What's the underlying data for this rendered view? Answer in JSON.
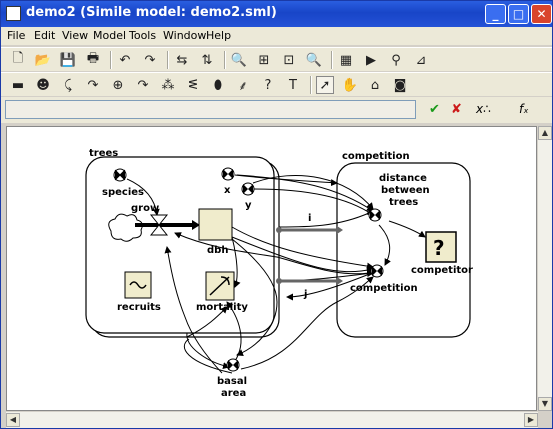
{
  "window": {
    "title": "demo2 (Simile model: demo2.sml)"
  },
  "menu": [
    "File",
    "Edit",
    "View",
    "Model",
    "Tools",
    "Window",
    "Help"
  ],
  "title_buttons": {
    "minimize": "_",
    "maximize": "□",
    "close": "✕"
  },
  "toolbar1_icons": [
    "new-file-icon",
    "open-folder-icon",
    "save-icon",
    "print-icon",
    "undo-icon",
    "redo-icon",
    "flip-horizontal-icon",
    "flip-vertical-icon",
    "zoom-in-icon",
    "zoom-fit-icon",
    "zoom-select-icon",
    "zoom-out-icon",
    "grid-icon",
    "run-icon",
    "binoculars-icon",
    "graph-icon"
  ],
  "toolbar2_icons": [
    "compartment-tool-icon",
    "variable-tool-icon",
    "flow-tool-icon",
    "influence-tool-icon",
    "submodel-tool-icon",
    "role-arrow-icon",
    "condition-tool-icon",
    "event-tool-icon",
    "migration-tool-icon",
    "function-tool-icon",
    "help-tool-icon",
    "text-tool-icon",
    "pointer-tool-icon",
    "hand-tool-icon",
    "plugin-tool-icon",
    "camera-tool-icon"
  ],
  "toolbar2_glyphs": [
    "▬",
    "☻",
    "⤹",
    "↷",
    "⊕",
    "↷",
    "⁂",
    "ᓬ",
    "⬮",
    "⸙",
    "?",
    "T",
    "➚",
    "✋",
    "⌂",
    "◙"
  ],
  "toolbar1_glyphs": [
    "🗋",
    "📂",
    "💾",
    "🖶",
    "↶",
    "↷",
    "⇆",
    "⇅",
    "🔍",
    "⊞",
    "⊡",
    "🔍",
    "▦",
    "▶",
    "⚲",
    "⊿"
  ],
  "expression_bar": {
    "value": "",
    "accept_icon": "✔",
    "cancel_icon": "✘",
    "x_icon": "x∴",
    "fx_icon": "fₓ"
  },
  "diagram": {
    "submodels": {
      "trees": "trees",
      "competition": "competition"
    },
    "nodes": {
      "species": "species",
      "grow": "grow",
      "dbh": "dbh",
      "x": "x",
      "y": "y",
      "recruits": "recruits",
      "mortality": "mortality",
      "basal_area_1": "basal",
      "basal_area_2": "area",
      "distance_1": "distance",
      "distance_2": "between",
      "distance_3": "trees",
      "competitor": "competitor",
      "competition_var": "competition",
      "role_i": "i",
      "role_j": "j",
      "competitor_glyph": "?"
    }
  }
}
